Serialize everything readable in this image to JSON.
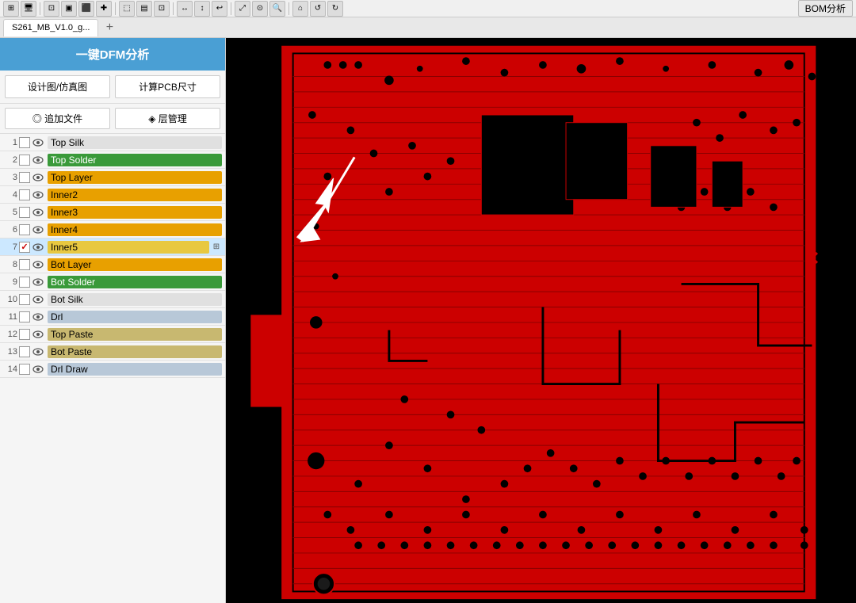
{
  "toolbar": {
    "bom_label": "BOM分析"
  },
  "tabbar": {
    "tab1_label": "S261_MB_V1.0_g..."
  },
  "sidebar": {
    "dfm_button": "一键DFM分析",
    "design_btn": "设计图/仿真图",
    "calc_btn": "计算PCB尺寸",
    "add_file_btn": "◎ 追加文件",
    "layer_mgmt_btn": "◈ 层管理"
  },
  "layers": [
    {
      "num": "1",
      "checked": false,
      "name": "Top Silk",
      "color": "#e0e0e0",
      "textColor": "#000"
    },
    {
      "num": "2",
      "checked": false,
      "name": "Top Solder",
      "color": "#3a9a3a",
      "textColor": "#fff"
    },
    {
      "num": "3",
      "checked": false,
      "name": "Top Layer",
      "color": "#e8a000",
      "textColor": "#000"
    },
    {
      "num": "4",
      "checked": false,
      "name": "Inner2",
      "color": "#e8a000",
      "textColor": "#000"
    },
    {
      "num": "5",
      "checked": false,
      "name": "Inner3",
      "color": "#e8a000",
      "textColor": "#000"
    },
    {
      "num": "6",
      "checked": false,
      "name": "Inner4",
      "color": "#e8a000",
      "textColor": "#000"
    },
    {
      "num": "7",
      "checked": true,
      "name": "Inner5",
      "color": "#e8c840",
      "textColor": "#000",
      "selected": true,
      "hasIcon": true
    },
    {
      "num": "8",
      "checked": false,
      "name": "Bot Layer",
      "color": "#e8a000",
      "textColor": "#000"
    },
    {
      "num": "9",
      "checked": false,
      "name": "Bot Solder",
      "color": "#3a9a3a",
      "textColor": "#fff"
    },
    {
      "num": "10",
      "checked": false,
      "name": "Bot Silk",
      "color": "#e0e0e0",
      "textColor": "#000"
    },
    {
      "num": "11",
      "checked": false,
      "name": "Drl",
      "color": "#b8c8d8",
      "textColor": "#000"
    },
    {
      "num": "12",
      "checked": false,
      "name": "Top Paste",
      "color": "#c8b870",
      "textColor": "#000"
    },
    {
      "num": "13",
      "checked": false,
      "name": "Bot Paste",
      "color": "#c8b870",
      "textColor": "#000"
    },
    {
      "num": "14",
      "checked": false,
      "name": "Drl Draw",
      "color": "#b8c8d8",
      "textColor": "#000"
    }
  ]
}
